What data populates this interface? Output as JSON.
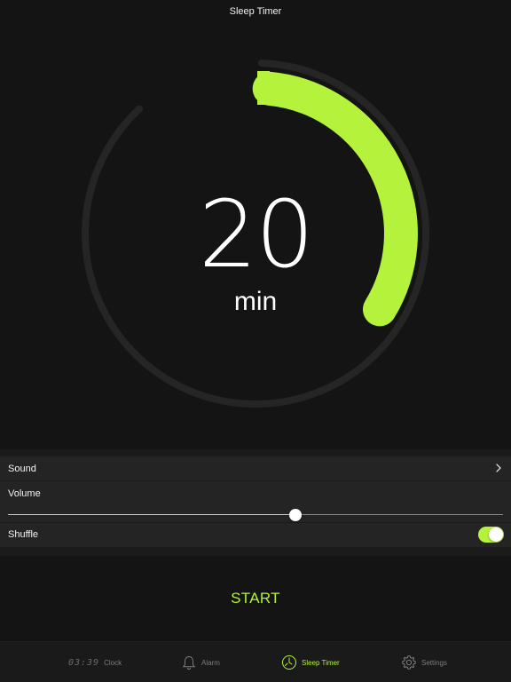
{
  "nav": {
    "title": "Sleep Timer"
  },
  "timer": {
    "value": "20",
    "unit": "min",
    "progress_fraction": 0.333
  },
  "settings": {
    "sound_label": "Sound",
    "volume_label": "Volume",
    "volume_level": 0.58,
    "shuffle_label": "Shuffle",
    "shuffle_on": true
  },
  "start_label": "START",
  "tabs": [
    {
      "label": "Clock",
      "icon": "clock-icon",
      "digits": "03:39",
      "active": false
    },
    {
      "label": "Alarm",
      "icon": "bell-icon",
      "active": false
    },
    {
      "label": "Sleep Timer",
      "icon": "sleep-timer-icon",
      "active": true
    },
    {
      "label": "Settings",
      "icon": "gear-icon",
      "active": false
    }
  ],
  "colors": {
    "accent": "#b4f23c",
    "background": "#141414",
    "row": "#242424",
    "track": "#252525"
  }
}
